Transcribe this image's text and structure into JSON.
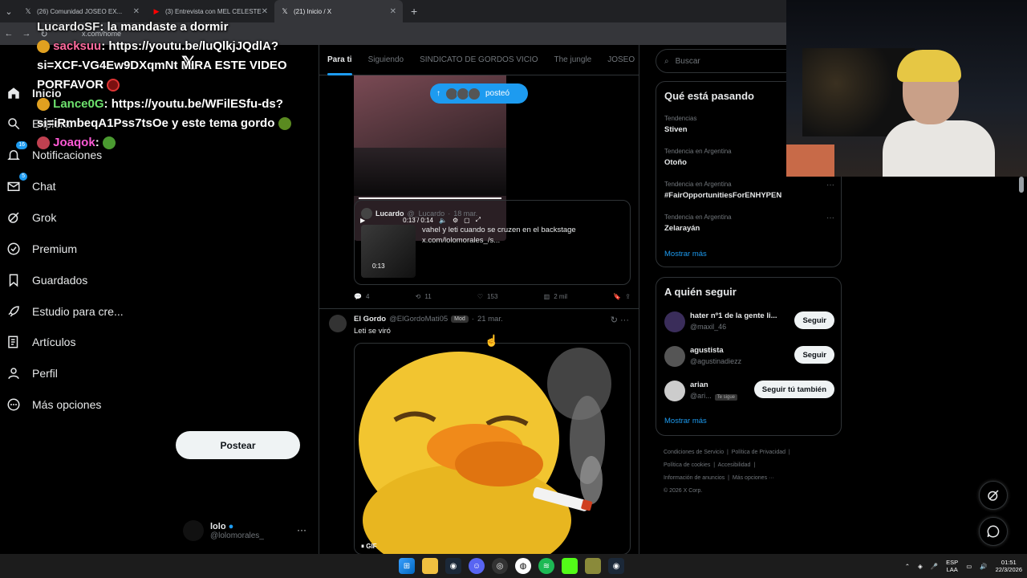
{
  "browser": {
    "tabs": [
      {
        "label": "(26) Comunidad JOSEO EX...",
        "active": false
      },
      {
        "label": "(3) Entrevista con MEL CELESTE",
        "active": false
      },
      {
        "label": "(21) Inicio / X",
        "active": true
      }
    ],
    "new_tab": "+",
    "url": "x.com/home"
  },
  "chat_overlay": [
    {
      "user": "LucardoSF",
      "user_color": "#e8e8e8",
      "text": "la mandaste a dormir"
    },
    {
      "user": "sacksuu",
      "user_color": "#ff6b9e",
      "text": "https://youtu.be/luQlkjJQdlA?si=XCF-VG4Ew9DXqmNt MIRA ESTE VIDEO PORFAVOR"
    },
    {
      "user": "Lance0G",
      "user_color": "#6ee36e",
      "text": "https://youtu.be/WFilESfu-ds?si=iRmbeqA1Pss7tsOe y este tema gordo"
    },
    {
      "user": "Joaqok",
      "user_color": "#ff5ad6",
      "text": ""
    }
  ],
  "nav": {
    "items": [
      {
        "label": "Inicio",
        "icon": "home-icon",
        "badge": ""
      },
      {
        "label": "Explorar",
        "icon": "search-icon",
        "badge": ""
      },
      {
        "label": "Notificaciones",
        "icon": "bell-icon",
        "badge": "16"
      },
      {
        "label": "Chat",
        "icon": "mail-icon",
        "badge": "5"
      },
      {
        "label": "Grok",
        "icon": "grok-icon",
        "badge": ""
      },
      {
        "label": "Premium",
        "icon": "verified-icon",
        "badge": ""
      },
      {
        "label": "Guardados",
        "icon": "bookmark-icon",
        "badge": ""
      },
      {
        "label": "Estudio para cre...",
        "icon": "rocket-icon",
        "badge": ""
      },
      {
        "label": "Artículos",
        "icon": "article-icon",
        "badge": ""
      },
      {
        "label": "Perfil",
        "icon": "person-icon",
        "badge": ""
      },
      {
        "label": "Más opciones",
        "icon": "more-circle-icon",
        "badge": ""
      }
    ],
    "post_button": "Postear",
    "profile": {
      "name": "lolo",
      "handle": "@lolomorales_"
    }
  },
  "feed": {
    "tabs": [
      "Para ti",
      "Siguiendo",
      "SINDICATO DE GORDOS VICIO",
      "The jungle",
      "JOSEO"
    ],
    "posted_pill": "posteó",
    "video": {
      "time": "0:13 / 0:14"
    },
    "quote": {
      "name": "Lucardo",
      "handle": "@_Lucardo",
      "date": "18 mar.",
      "duration": "0:13",
      "text": "vahel y leti cuando se cruzen en el backstage x.com/lolomorales_/s..."
    },
    "actions": {
      "replies": "4",
      "reposts": "11",
      "likes": "153",
      "views": "2 mil"
    },
    "post2": {
      "name": "El Gordo",
      "handle": "@ElGordoMati05",
      "badge": "Mod",
      "date": "21 mar.",
      "text": "Leti se viró",
      "gif_label": "GIF"
    }
  },
  "sidebar": {
    "search_placeholder": "Buscar",
    "trends_title": "Qué está pasando",
    "trends": [
      {
        "context": "Tendencias",
        "topic": "Stiven"
      },
      {
        "context": "Tendencia en Argentina",
        "topic": "Otoño"
      },
      {
        "context": "Tendencia en Argentina",
        "topic": "#FairOpportunitiesForENHYPEN"
      },
      {
        "context": "Tendencia en Argentina",
        "topic": "Zelarayán"
      }
    ],
    "show_more": "Mostrar más",
    "follow_title": "A quién seguir",
    "follow": [
      {
        "name": "hater nº1 de la gente li...",
        "handle": "@maxil_46",
        "button": "Seguir",
        "follows_you": ""
      },
      {
        "name": "agustista",
        "handle": "@agustinadiezz",
        "button": "Seguir",
        "follows_you": ""
      },
      {
        "name": "arian",
        "handle": "@ari...",
        "button": "Seguir tú también",
        "follows_you": "Te sigue"
      }
    ],
    "footer": {
      "links": [
        "Condiciones de Servicio",
        "Política de Privacidad",
        "Política de cookies",
        "Accesibilidad",
        "Información de anuncios",
        "Más opciones ···"
      ],
      "copyright": "© 2026 X Corp."
    }
  },
  "taskbar": {
    "lang_top": "ESP",
    "lang_bottom": "LAA",
    "time": "01:51",
    "date": "22/3/2026"
  },
  "colors": {
    "accent": "#1d9bf0",
    "background": "#000000",
    "border": "#2f3336"
  }
}
